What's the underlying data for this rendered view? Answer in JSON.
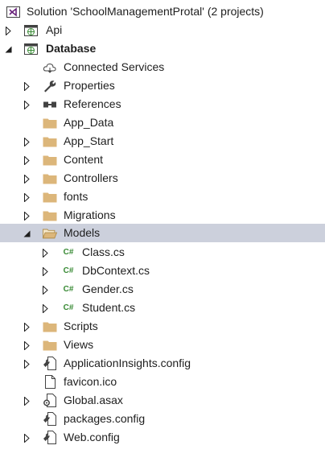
{
  "solution": {
    "label": "Solution 'SchoolManagementProtal' (2 projects)",
    "icon": "vs-solution-icon"
  },
  "projects": [
    {
      "label": "Api",
      "expanded": false,
      "icon": "web-project-icon"
    },
    {
      "label": "Database",
      "expanded": true,
      "icon": "web-project-icon"
    }
  ],
  "items": {
    "connected_services": "Connected Services",
    "properties": "Properties",
    "references": "References",
    "app_data": "App_Data",
    "app_start": "App_Start",
    "content": "Content",
    "controllers": "Controllers",
    "fonts": "fonts",
    "migrations": "Migrations",
    "models": "Models",
    "scripts": "Scripts",
    "views": "Views",
    "appinsights": "ApplicationInsights.config",
    "favicon": "favicon.ico",
    "global": "Global.asax",
    "packages": "packages.config",
    "webconfig": "Web.config"
  },
  "models_children": [
    "Class.cs",
    "DbContext.cs",
    "Gender.cs",
    "Student.cs"
  ],
  "csharp_badge": "C#",
  "colors": {
    "selected_row": "#ccd0dc",
    "folder": "#dcb67a",
    "solution_icon": "#68217a",
    "csharp": "#388a34",
    "web_globe": "#1ba1e2"
  }
}
